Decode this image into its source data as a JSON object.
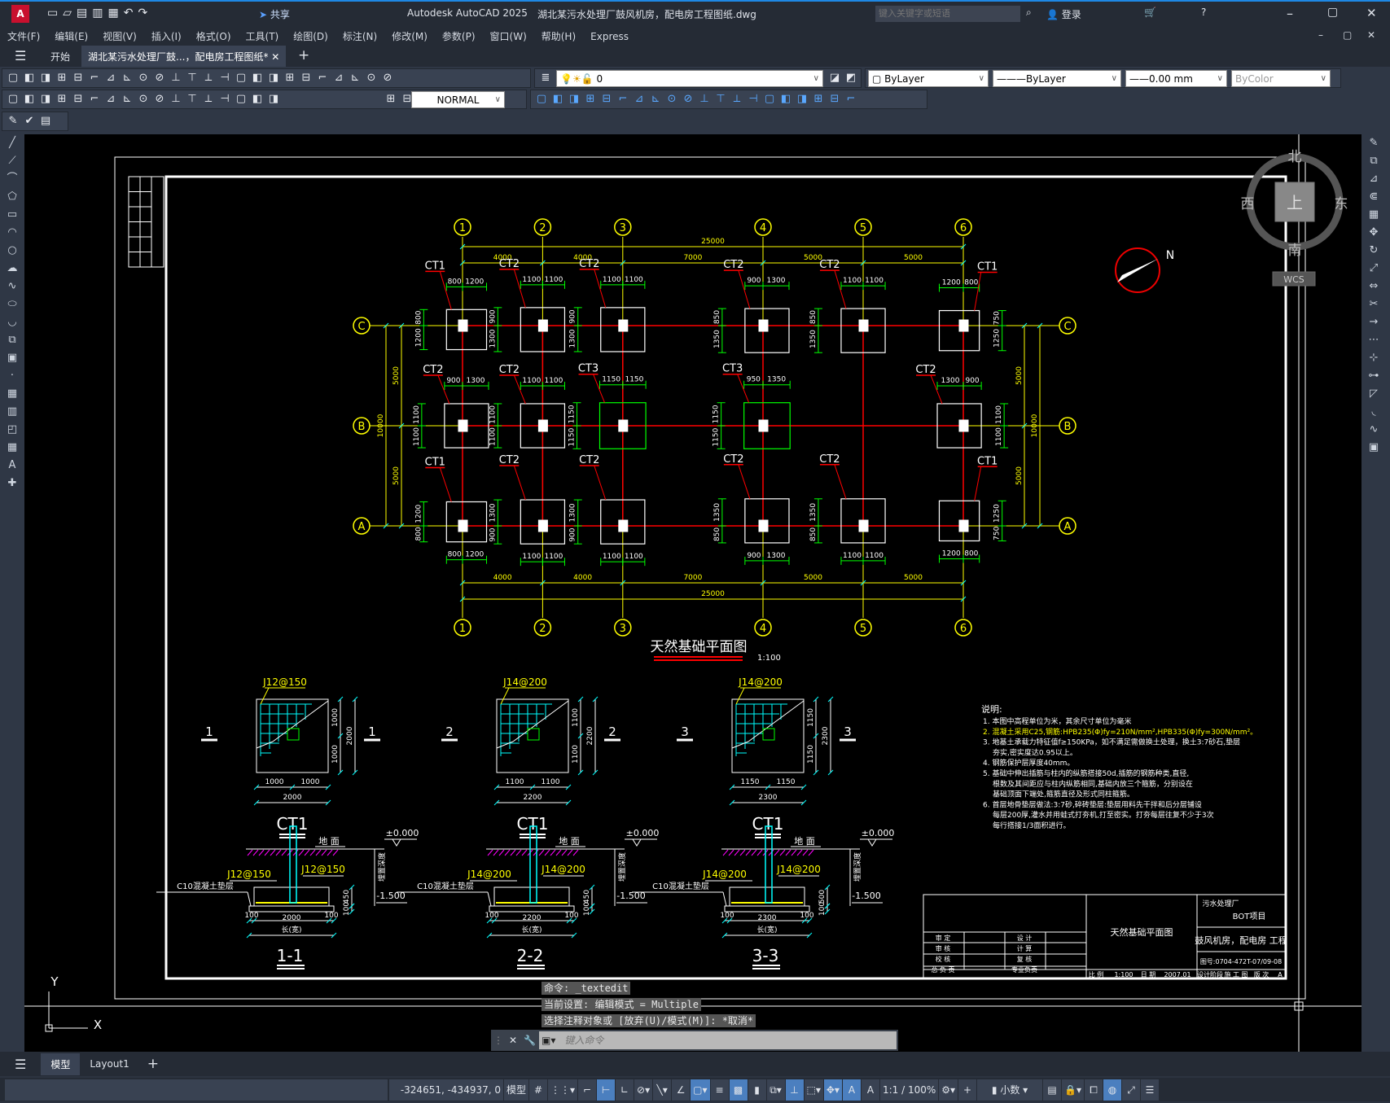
{
  "titlebar": {
    "app_title": "Autodesk AutoCAD 2025",
    "file_title": "湖北某污水处理厂鼓风机房，配电房工程图纸.dwg",
    "share": "共享",
    "search_placeholder": "键入关键字或短语",
    "login": "登录",
    "logo": "A"
  },
  "menu": [
    "文件(F)",
    "编辑(E)",
    "视图(V)",
    "插入(I)",
    "格式(O)",
    "工具(T)",
    "绘图(D)",
    "标注(N)",
    "修改(M)",
    "参数(P)",
    "窗口(W)",
    "帮助(H)",
    "Express"
  ],
  "tabs": {
    "start": "开始",
    "document": "湖北某污水处理厂鼓...，配电房工程图纸*"
  },
  "toolbar": {
    "layer": "0",
    "color": "ByLayer",
    "linetype": "ByLayer",
    "lineweight": "0.00 mm",
    "plotstyle": "ByColor",
    "textstyle": "NORMAL",
    "row1_icons": [
      "new",
      "open",
      "save",
      "print",
      "preview",
      "publish",
      "dwf",
      "cut",
      "copy",
      "paste",
      "match",
      "undo",
      "redo",
      "pan",
      "zoom-realtime",
      "zoom-window",
      "zoom-previous",
      "properties",
      "design-center",
      "tool-palette",
      "sheet-set",
      "markup",
      "calc",
      "help"
    ],
    "row2_icons": [
      "dim-linear",
      "dim-aligned",
      "dim-arc",
      "dim-ordinate",
      "dim-radius",
      "dim-jogged",
      "dim-diameter",
      "dim-angular",
      "quick-dim",
      "dim-baseline",
      "dim-continue",
      "dim-space",
      "dim-break",
      "tolerance",
      "center-mark",
      "inspect",
      "jogged-linear",
      "dim-edit",
      "dim-text-edit",
      "dim-update"
    ],
    "row2b_icons": [
      "erase",
      "copy-obj",
      "mirror",
      "offset",
      "array",
      "move",
      "rotate",
      "scale",
      "stretch",
      "trim",
      "extend",
      "break-point",
      "break",
      "join",
      "chamfer",
      "fillet",
      "explode",
      "align",
      "block",
      "insert"
    ]
  },
  "viewcube": {
    "north": "北",
    "south": "南",
    "east": "东",
    "west": "西",
    "top": "上",
    "wcs": "WCS"
  },
  "ucs": {
    "x": "X",
    "y": "Y"
  },
  "north_arrow": "N",
  "command": {
    "history": [
      "命令: _textedit",
      "当前设置: 编辑模式 = Multiple",
      "选择注释对象或 [放弃(U)/模式(M)]: *取消*"
    ],
    "placeholder": "键入命令"
  },
  "layout_tabs": [
    "模型",
    "Layout1"
  ],
  "status": {
    "coords": "-324651, -434937, 0",
    "model": "模型",
    "scale": "1:1 / 100%",
    "units": "小数"
  },
  "drawing": {
    "colors": {
      "grid": "#ffff00",
      "axis_line": "#ff0000",
      "dim": "#00ff00",
      "footing": "#ffffff",
      "rebar": "#00ffff",
      "ground": "#ff00ff"
    },
    "plan": {
      "title": "天然基础平面图",
      "scale": "1:100",
      "columns": [
        "1",
        "2",
        "3",
        "4",
        "5",
        "6"
      ],
      "column_spacings": [
        4000,
        4000,
        7000,
        5000,
        5000
      ],
      "total_width": "25000",
      "rows": [
        "C",
        "B",
        "A"
      ],
      "row_spacings": [
        5000,
        5000
      ],
      "total_depth": "10000",
      "footings": [
        {
          "col": 0,
          "row": 0,
          "label": "CT1",
          "l": 800,
          "r": 1200,
          "u": 800,
          "d": 1200
        },
        {
          "col": 1,
          "row": 0,
          "label": "CT2",
          "l": 1100,
          "r": 1100,
          "u": 900,
          "d": 1300
        },
        {
          "col": 2,
          "row": 0,
          "label": "CT2",
          "l": 1100,
          "r": 1100,
          "u": 900,
          "d": 1300
        },
        {
          "col": 3,
          "row": 0,
          "label": "CT2",
          "l": 900,
          "r": 1300,
          "u": 850,
          "d": 1350
        },
        {
          "col": 4,
          "row": 0,
          "label": "CT2",
          "l": 1100,
          "r": 1100,
          "u": 850,
          "d": 1350
        },
        {
          "col": 5,
          "row": 0,
          "label": "CT1",
          "l": 1200,
          "r": 800,
          "u": 750,
          "d": 1250
        },
        {
          "col": 0,
          "row": 1,
          "label": "CT2",
          "l": 900,
          "r": 1300,
          "u": 1100,
          "d": 1100
        },
        {
          "col": 1,
          "row": 1,
          "label": "CT2",
          "l": 1100,
          "r": 1100,
          "u": 1100,
          "d": 1100
        },
        {
          "col": 2,
          "row": 1,
          "label": "CT3",
          "l": 1150,
          "r": 1150,
          "u": 1150,
          "d": 1150
        },
        {
          "col": 3,
          "row": 1,
          "label": "CT3",
          "l": 950,
          "r": 1350,
          "u": 1150,
          "d": 1150
        },
        {
          "col": 5,
          "row": 1,
          "label": "CT2",
          "l": 1300,
          "r": 900,
          "u": 1100,
          "d": 1100
        },
        {
          "col": 0,
          "row": 2,
          "label": "CT1",
          "l": 800,
          "r": 1200,
          "u": 1200,
          "d": 800
        },
        {
          "col": 1,
          "row": 2,
          "label": "CT2",
          "l": 1100,
          "r": 1100,
          "u": 1300,
          "d": 900
        },
        {
          "col": 2,
          "row": 2,
          "label": "CT2",
          "l": 1100,
          "r": 1100,
          "u": 1300,
          "d": 900
        },
        {
          "col": 3,
          "row": 2,
          "label": "CT2",
          "l": 900,
          "r": 1300,
          "u": 1350,
          "d": 850
        },
        {
          "col": 4,
          "row": 2,
          "label": "CT2",
          "l": 1100,
          "r": 1100,
          "u": 1350,
          "d": 850
        },
        {
          "col": 5,
          "row": 2,
          "label": "CT1",
          "l": 1200,
          "r": 800,
          "u": 1250,
          "d": 750
        }
      ]
    },
    "details": [
      {
        "mark": "1",
        "name": "CT1",
        "rebar": "J12@150",
        "rebar2": "J12@150",
        "half": [
          "1000",
          "1000"
        ],
        "total": "2000",
        "vhalf": [
          "1000",
          "1000"
        ],
        "vtotal": "2000",
        "section": "1-1",
        "thick": "450"
      },
      {
        "mark": "2",
        "name": "CT1",
        "rebar": "J14@200",
        "rebar2": "J14@200",
        "half": [
          "1100",
          "1100"
        ],
        "total": "2200",
        "vhalf": [
          "1100",
          "1100"
        ],
        "vtotal": "2200",
        "section": "2-2",
        "thick": "450"
      },
      {
        "mark": "3",
        "name": "CT1",
        "rebar": "J14@200",
        "rebar2": "J14@200",
        "half": [
          "1150",
          "1150"
        ],
        "total": "2300",
        "vhalf": [
          "1150",
          "1150"
        ],
        "vtotal": "2300",
        "section": "3-3",
        "thick": "500"
      }
    ],
    "section_labels": {
      "ground": "地 面",
      "zero": "±0.000",
      "depth_level": "-1.500",
      "cushion": "C10混凝土垫层",
      "embed": "埋置深度",
      "width": "长(宽)",
      "offset": "100",
      "cushion_thick": "100"
    },
    "notes": {
      "title": "说明:",
      "items": [
        "1. 本图中高程单位为米，其余尺寸单位为毫米",
        "2. 混凝土采用C25,钢筋:HPB235(Φ)fy=210N/mm²,HPB335(Φ)fy=300N/mm²。",
        "3. 地基土承载力特征值f≥150KPa，如不满足需做换土处理，换土3:7砂石,垫层",
        "   夯实,密实度达0.95以上。",
        "4. 钢筋保护层厚度40mm。",
        "5. 基础中伸出插筋与柱内的纵筋搭接50d,插筋的钢筋种类,直径,",
        "   根数及其间距应与柱内纵筋相同,基础内放三个箍筋，分别设在",
        "   基础顶面下端处,箍筋直径及形式同柱箍筋。",
        "6. 首层地骨垫层做法:3:7砂,碎砖垫层:垫层用料先干拌和后分层铺设",
        "   每层200厚,灌水并用蛙式打夯机,打至密实。打夯每层往复不少于3次",
        "   每行搭接1/3面积进行。"
      ]
    },
    "titleblock": {
      "client": "污水处理厂",
      "project": "BOT项目",
      "drawing_name": "天然基础平面图",
      "work": "鼓风机房，配电房 工程",
      "number": "图号:0704-472T-07/09-08",
      "roles": [
        [
          "审 定",
          "设 计"
        ],
        [
          "审 核",
          "计 算"
        ],
        [
          "校 核",
          "复 核"
        ],
        [
          "总 负 责",
          "专业负责"
        ]
      ],
      "scale_label": "比 例",
      "scale": "1:100",
      "date_label": "日 期",
      "date": "2007.01",
      "stage_label": "设计阶段",
      "stage": "施 工 图",
      "version_label": "版 次",
      "version": "A"
    }
  }
}
